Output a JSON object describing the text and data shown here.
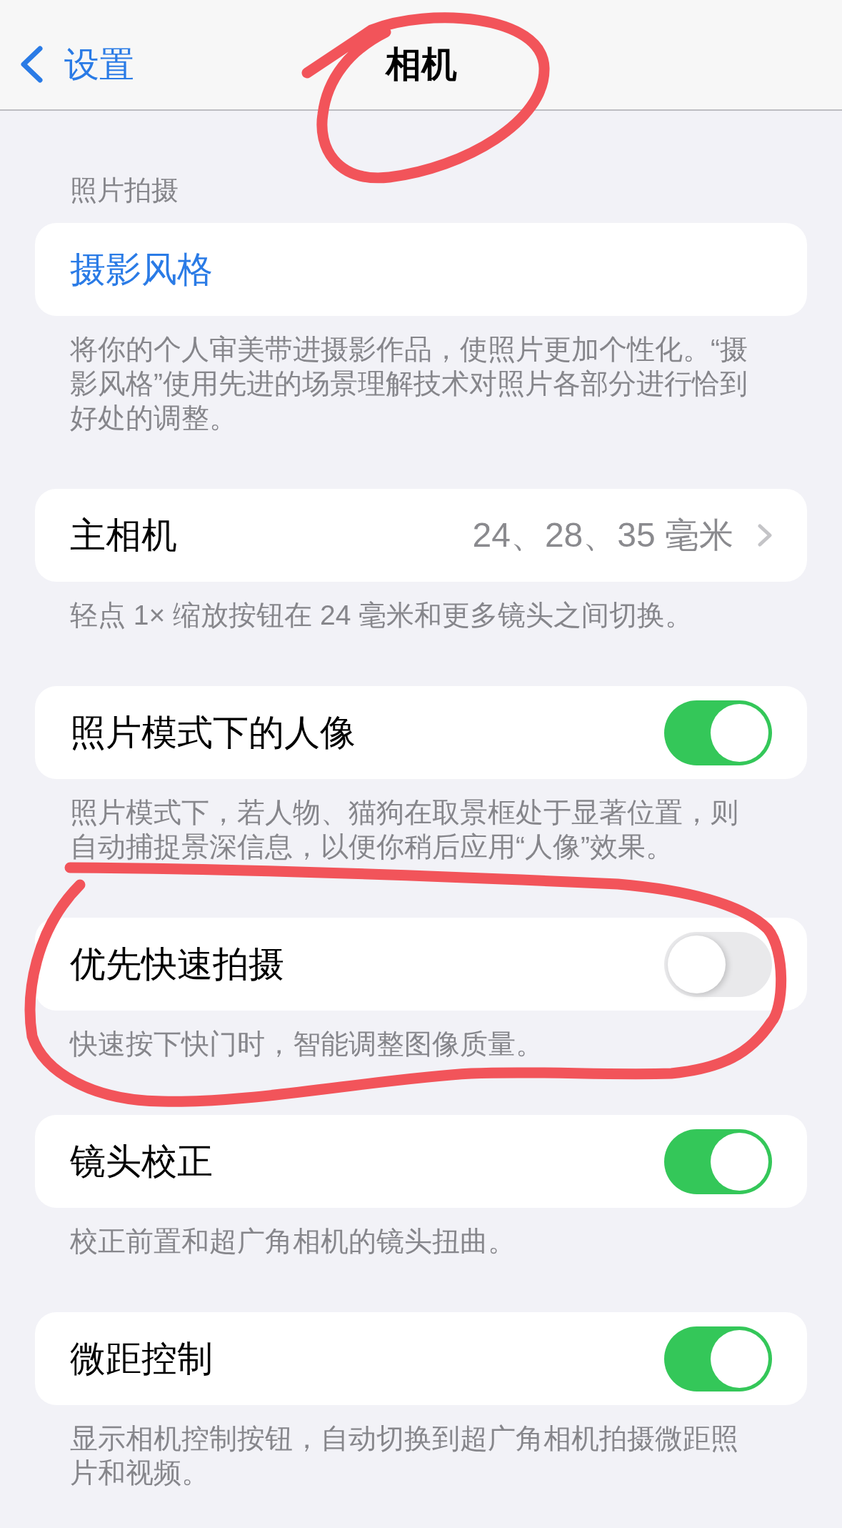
{
  "nav": {
    "back": "设置",
    "title": "相机"
  },
  "sections": [
    {
      "header": "照片拍摄",
      "row": {
        "kind": "link",
        "label": "摄影风格"
      },
      "footer": "将你的个人审美带进摄影作品，使照片更加个性化。“摄影风格”使用先进的场景理解技术对照片各部分进行恰到好处的调整。"
    },
    {
      "row": {
        "kind": "detail",
        "label": "主相机",
        "value": "24、28、35 毫米"
      },
      "footer": "轻点 1× 缩放按钮在 24 毫米和更多镜头之间切换。"
    },
    {
      "row": {
        "kind": "toggle",
        "label": "照片模式下的人像",
        "on": true
      },
      "footer": "照片模式下，若人物、猫狗在取景框处于显著位置，则自动捕捉景深信息，以便你稍后应用“人像”效果。"
    },
    {
      "row": {
        "kind": "toggle",
        "label": "优先快速拍摄",
        "on": false
      },
      "footer": "快速按下快门时，智能调整图像质量。"
    },
    {
      "row": {
        "kind": "toggle",
        "label": "镜头校正",
        "on": true
      },
      "footer": "校正前置和超广角相机的镜头扭曲。"
    },
    {
      "row": {
        "kind": "toggle",
        "label": "微距控制",
        "on": true
      },
      "footer": "显示相机控制按钮，自动切换到超广角相机拍摄微距照片和视频。"
    }
  ]
}
